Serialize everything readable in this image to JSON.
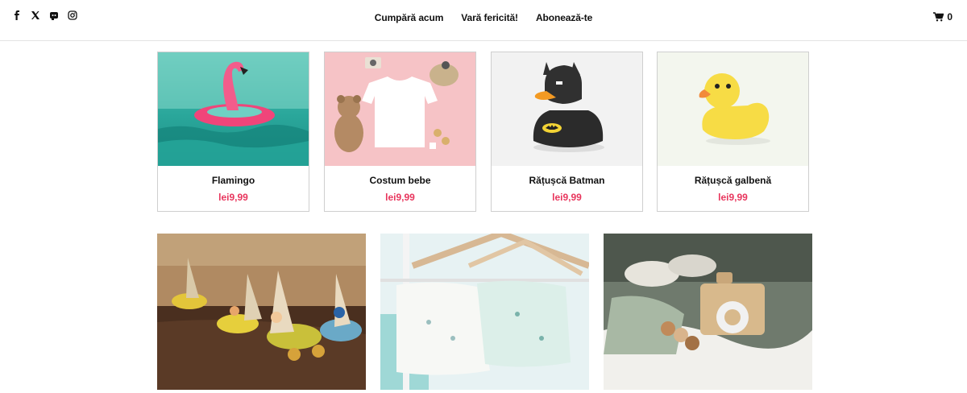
{
  "header": {
    "social": [
      {
        "icon": "facebook-icon"
      },
      {
        "icon": "x-icon"
      },
      {
        "icon": "discord-icon"
      },
      {
        "icon": "instagram-icon"
      }
    ],
    "nav": [
      "Cumpără acum",
      "Vară fericită!",
      "Abonează-te"
    ],
    "cart_count": "0"
  },
  "products": [
    {
      "name": "Flamingo",
      "price": "lei9,99"
    },
    {
      "name": "Costum bebe",
      "price": "lei9,99"
    },
    {
      "name": "Rățușcă Batman",
      "price": "lei9,99"
    },
    {
      "name": "Rățușcă galbenă",
      "price": "lei9,99"
    }
  ],
  "colors": {
    "price": "#e8365d",
    "border": "#cfcfcf"
  }
}
